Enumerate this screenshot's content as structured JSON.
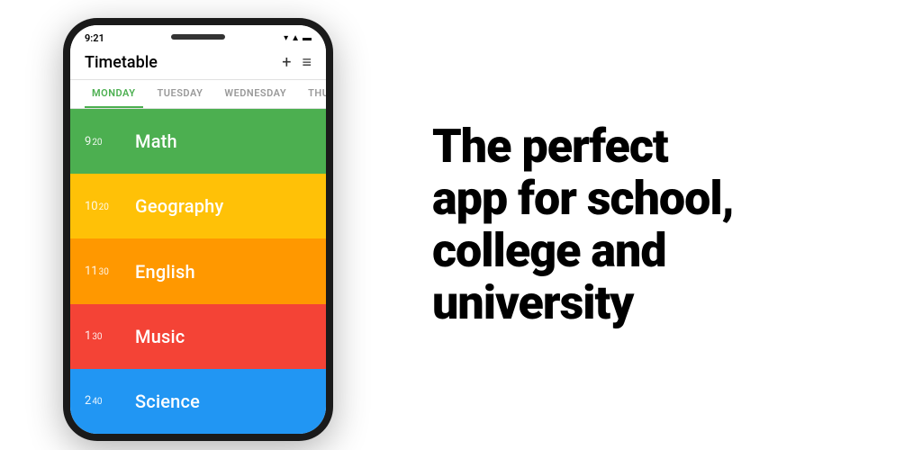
{
  "phone": {
    "status": {
      "time": "9:21",
      "signal_icon": "▲▲",
      "wifi_icon": "▼",
      "battery_icon": "▪"
    },
    "header": {
      "title": "Timetable",
      "add_label": "+",
      "menu_label": "≡"
    },
    "tabs": [
      {
        "label": "MONDAY",
        "active": true
      },
      {
        "label": "TUESDAY",
        "active": false
      },
      {
        "label": "WEDNESDAY",
        "active": false
      },
      {
        "label": "THURSDAY",
        "active": false
      }
    ],
    "schedule": [
      {
        "hour": "9",
        "min": "20",
        "subject": "Math",
        "color_class": "item-math"
      },
      {
        "hour": "10",
        "min": "20",
        "subject": "Geography",
        "color_class": "item-geography"
      },
      {
        "hour": "11",
        "min": "30",
        "subject": "English",
        "color_class": "item-english"
      },
      {
        "hour": "1",
        "min": "30",
        "subject": "Music",
        "color_class": "item-music"
      },
      {
        "hour": "2",
        "min": "40",
        "subject": "Science",
        "color_class": "item-science"
      }
    ]
  },
  "tagline": {
    "line1": "The perfect",
    "line2": "app for school,",
    "line3": "college and",
    "line4": "university"
  }
}
